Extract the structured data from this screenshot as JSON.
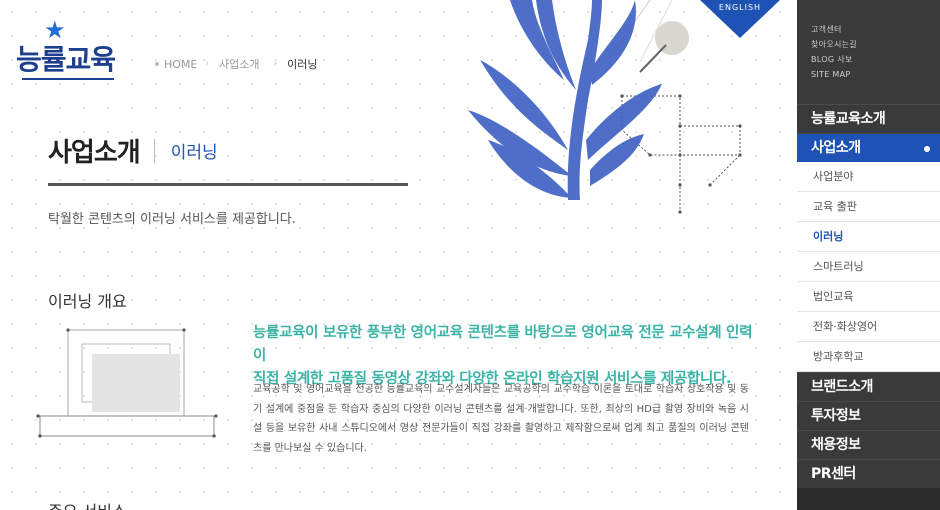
{
  "logo": {
    "text": "능률교육",
    "star": "★"
  },
  "breadcrumb": {
    "home": "HOME",
    "level1": "사업소개",
    "current": "이러닝"
  },
  "english_label": "ENGLISH",
  "page": {
    "title": "사업소개",
    "subtitle": "이러닝",
    "lead": "탁월한 콘텐츠의 이러닝 서비스를 제공합니다."
  },
  "overview": {
    "title": "이러닝 개요",
    "highlight_line1": "능률교육이 보유한 풍부한 영어교육 콘텐츠를 바탕으로 영어교육 전문 교수설계 인력이",
    "highlight_line2": "직접 설계한 고품질 동영상 강좌와 다양한 온라인 학습지원 서비스를 제공합니다.",
    "body": "교육공학 및 영어교육을 전공한 능률교육의 교수설계자들은 교육공학의 교수학습 이론을 토대로 학습자 상호작용 및 동기 설계에 중점을 둔 학습자 중심의 다양한 이러닝 콘텐츠를 설계·개발합니다. 또한, 최상의 HD급 촬영 장비와 녹음 시설 등을 보유한 사내 스튜디오에서 영상 전문가들이 직접 강좌를 촬영하고 제작함으로써 업계 최고 품질의 이러닝 콘텐츠를 만나보실 수 있습니다."
  },
  "services": {
    "title": "주요 서비스"
  },
  "sidebar": {
    "util_links": [
      "고객센터",
      "찾아오시는길",
      "BLOG 사보",
      "SITE MAP"
    ],
    "menu_intro": "능률교육소개",
    "menu_business": "사업소개",
    "sub_items": [
      "사업분야",
      "교육 출판",
      "이러닝",
      "스마트러닝",
      "법인교육",
      "전화·화상영어",
      "방과후학교"
    ],
    "menu_brand": "브랜드소개",
    "menu_invest": "투자정보",
    "menu_recruit": "채용정보",
    "menu_pr": "PR센터"
  },
  "colors": {
    "accent": "#1e52b5",
    "teal": "#3bb3a5",
    "sidebar_dark": "#3a3a3a"
  }
}
